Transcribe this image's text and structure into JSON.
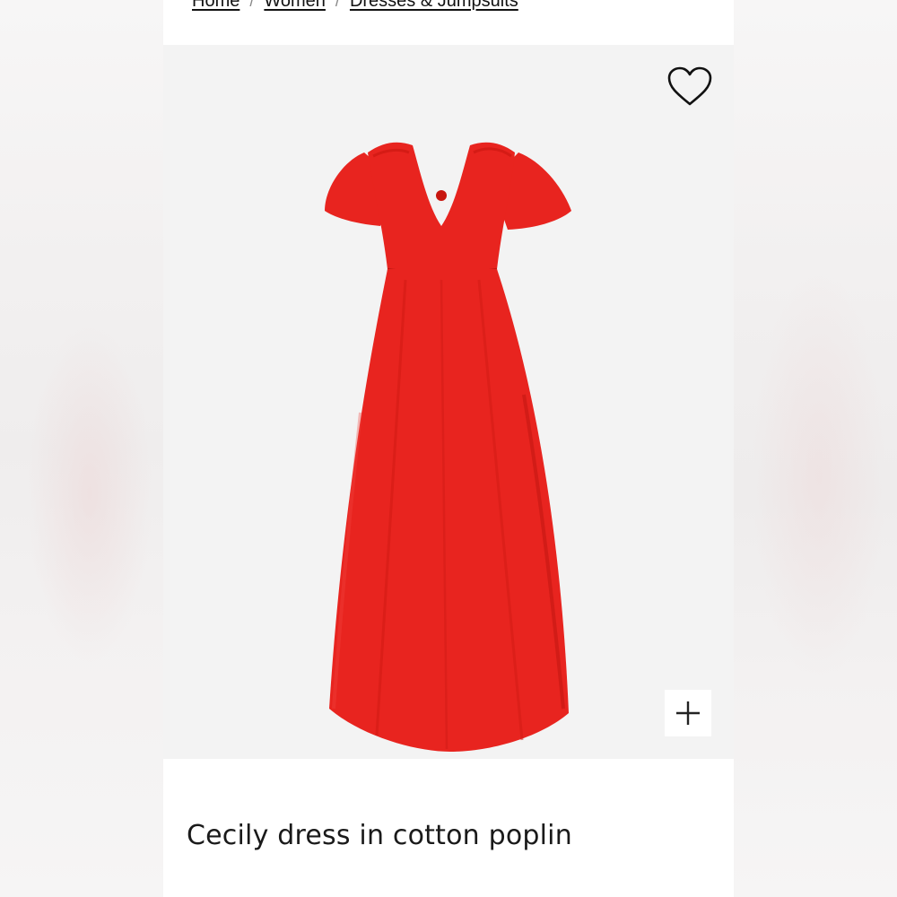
{
  "breadcrumb": {
    "items": [
      "Home",
      "Women",
      "Dresses & Jumpsuits"
    ],
    "separator": "/"
  },
  "product": {
    "name": "Cecily dress in cotton poplin",
    "image_alt": "Red cotton poplin dress with flutter sleeves",
    "color": "#e8241f"
  },
  "icons": {
    "wishlist": "heart-outline-icon",
    "zoom": "plus-icon"
  }
}
